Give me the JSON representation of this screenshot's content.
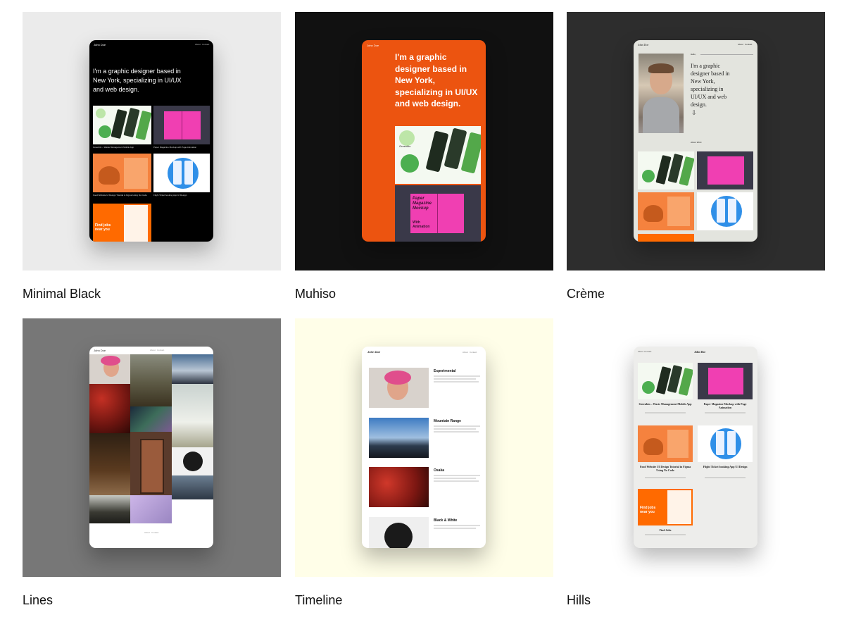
{
  "templates": [
    {
      "name": "Minimal Black",
      "bg": "#ebebeb"
    },
    {
      "name": "Muhiso",
      "bg": "#111111"
    },
    {
      "name": "Crème",
      "bg": "#2d2d2d"
    },
    {
      "name": "Lines",
      "bg": "#777777"
    },
    {
      "name": "Timeline",
      "bg": "#fffee8"
    },
    {
      "name": "Hills",
      "bg": "#ffffff"
    }
  ],
  "preview": {
    "author": "John Doe",
    "nav_about": "About",
    "nav_contact": "Contact",
    "headline": "I'm a graphic designer based in New York, specializing in UI/UX and web design.",
    "hello": "Hello,",
    "about_work": "About Work",
    "projects": {
      "greenbin": "Greenbin – Waste Management Mobile App",
      "magazine": "Paper Magazine Mockup with Page Animation",
      "food": "Food Website UI Design Tutorial in Figma Using No Code",
      "flight": "Flight Ticket booking App UI Design",
      "jobs": "Find Jobs"
    },
    "magazine_art": "Paper Magazine Mockup",
    "with_animation": "With Animation",
    "jobs_art": "Find jobs near you",
    "greenbin_art": "Greenbin",
    "timeline": [
      {
        "title": "Experimental"
      },
      {
        "title": "Mountain Range"
      },
      {
        "title": "Osaka"
      },
      {
        "title": "Black & White"
      }
    ]
  }
}
